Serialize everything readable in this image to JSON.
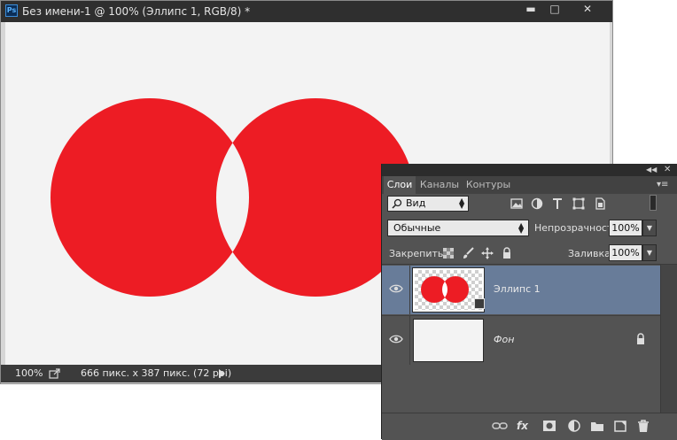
{
  "document": {
    "title": "Без имени-1 @ 100% (Эллипс 1, RGB/8) *",
    "app_icon": "Ps",
    "window_buttons": {
      "minimize": "▬",
      "maximize": "□",
      "close": "✕"
    },
    "zoom": "100%",
    "doc_info": "666 пикс. x 387 пикс. (72 ppi)",
    "shape_color": "#ed1c24",
    "canvas_color": "#f3f3f3"
  },
  "layers_panel": {
    "tabs": [
      "Слои",
      "Каналы",
      "Контуры"
    ],
    "active_tab": "Слои",
    "filter": {
      "label": "Вид",
      "icon": "search-icon"
    },
    "blend_mode": "Обычные",
    "opacity_label": "Непрозрачность:",
    "opacity_value": "100%",
    "lock_label": "Закрепить:",
    "fill_label": "Заливка:",
    "fill_value": "100%",
    "layers": [
      {
        "name": "Эллипс 1",
        "selected": true,
        "visible": true
      },
      {
        "name": "Фон",
        "selected": false,
        "visible": true,
        "locked": true
      }
    ],
    "bottom_icons": [
      "link-icon",
      "fx-icon",
      "mask-icon",
      "adjustment-icon",
      "group-icon",
      "new-layer-icon",
      "delete-icon"
    ],
    "fx_label": "fx"
  }
}
